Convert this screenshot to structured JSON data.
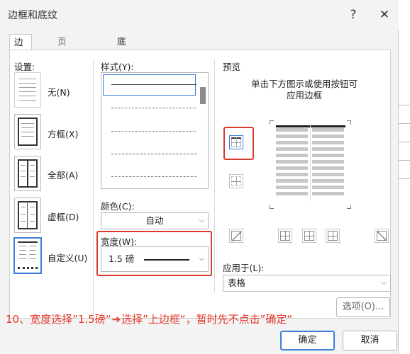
{
  "dialog": {
    "title": "边框和底纹",
    "help_label": "?",
    "close_label": "✕"
  },
  "tabs": [
    {
      "label": "边框(B)",
      "active": true
    },
    {
      "label": "页面边框(P)",
      "active": false
    },
    {
      "label": "底纹(S)",
      "active": false
    }
  ],
  "settings": {
    "heading": "设置:",
    "options": [
      {
        "label": "无(N)"
      },
      {
        "label": "方框(X)"
      },
      {
        "label": "全部(A)"
      },
      {
        "label": "虚框(D)"
      },
      {
        "label": "自定义(U)",
        "selected": true
      }
    ]
  },
  "style": {
    "heading": "样式(Y):",
    "items": [
      "solid",
      "dotted",
      "dotted-fine",
      "dashed",
      "dash-dot",
      "dash-dot-dot"
    ]
  },
  "color": {
    "heading": "颜色(C):",
    "value": "自动"
  },
  "width": {
    "heading": "宽度(W):",
    "value": "1.5 磅"
  },
  "preview": {
    "heading": "预览",
    "hint_line1": "单击下方图示或使用按钮可",
    "hint_line2": "应用边框"
  },
  "apply_to": {
    "heading": "应用于(L):",
    "value": "表格"
  },
  "buttons": {
    "options": "选项(O)...",
    "ok": "确定",
    "cancel": "取消"
  },
  "annotation": {
    "part1": "10、宽度选择”1.5磅“",
    "arrow": "➔",
    "part2": "选择”上边框“，暂时先不点击”确定“"
  },
  "colors": {
    "highlight_red": "#d93a2b",
    "annotation_red": "#e3372a",
    "selection_blue": "#3c7fd9"
  }
}
